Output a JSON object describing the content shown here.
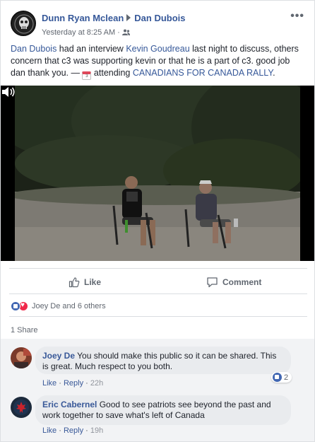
{
  "post": {
    "author": "Dunn Ryan Mclean",
    "target": "Dan Dubois",
    "timestamp": "Yesterday at 8:25 AM",
    "audience_icon": "friends-icon",
    "more_label": "•••",
    "body": {
      "mention_1": "Dan Dubois",
      "t1": " had an interview ",
      "mention_2": "Kevin Goudreau",
      "t2": " last night to discuss, others concern that c3 was supporting kevin or that he is a part of c3. good job dan thank you. — ",
      "calendar_day": "3",
      "t3": " attending ",
      "event": "CANADIANS FOR CANADA RALLY",
      "t4": "."
    }
  },
  "actions": {
    "like": "Like",
    "comment": "Comment"
  },
  "reactions": {
    "summary": "Joey De and 6 others",
    "types": [
      "like",
      "love"
    ]
  },
  "shares": "1 Share",
  "comments": [
    {
      "author": "Joey De",
      "text": "You should make this public so it can be shared. This is great. Much respect to you both.",
      "like": "Like",
      "reply": "Reply",
      "time": "22h",
      "reaction_count": "2"
    },
    {
      "author": "Eric Cabernel",
      "text": "Good to see patriots see beyond the past and work together to save what's left of Canada",
      "like": "Like",
      "reply": "Reply",
      "time": "19h"
    }
  ],
  "colors": {
    "link": "#365899",
    "like_blue": "#4267b2",
    "love_red": "#f0284a"
  }
}
